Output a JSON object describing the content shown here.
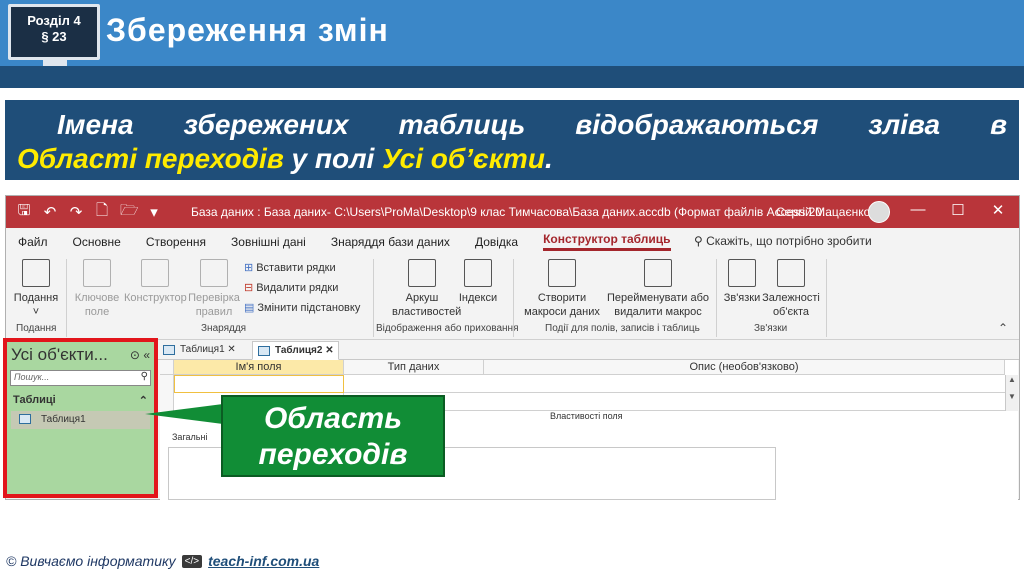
{
  "slide": {
    "section": "Розділ 4",
    "paragraph": "§ 23",
    "title": "Збереження змін"
  },
  "banner": {
    "line1": [
      "Імена",
      "збережених",
      "таблиць",
      "відображаються",
      "зліва",
      "в"
    ],
    "highlight1": "Області переходів",
    "middle": " у полі ",
    "highlight2": "Усі об’єкти",
    "end": "."
  },
  "window": {
    "title": "База даних : База даних- C:\\Users\\ProMa\\Desktop\\9 клас Тимчасова\\База даних.accdb (Формат файлів Access 20...",
    "user": "Сергій Мацаєнко",
    "menu": [
      "Файл",
      "Основне",
      "Створення",
      "Зовнішні дані",
      "Знаряддя бази даних",
      "Довідка",
      "Конструктор таблиць"
    ],
    "tell_me": "Скажіть, що потрібно зробити"
  },
  "ribbon": {
    "view": "Подання",
    "view_group": "Подання",
    "primary_key": "Ключове поле",
    "builder": "Конструктор",
    "test_rules": "Перевірка правил",
    "insert_rows": "Вставити рядки",
    "delete_rows": "Видалити рядки",
    "modify_lookups": "Змінити підстановку",
    "tools_group": "Знаряддя",
    "property_sheet": "Аркуш властивостей",
    "indexes": "Індекси",
    "showhide_group": "Відображення або приховання",
    "create_macros": "Створити макроси даних",
    "rename_macro": "Перейменувати або видалити макрос",
    "events_group": "Події для полів, записів і таблиць",
    "relationships": "Зв'язки",
    "dependencies": "Залежності об'єкта",
    "relations_group": "Зв'язки"
  },
  "nav": {
    "header": "Усі об'єкти...",
    "search_placeholder": "Пошук...",
    "category": "Таблиці",
    "item": "Таблиця1"
  },
  "tabs": [
    "Таблиця1",
    "Таблиця2"
  ],
  "grid": {
    "headers": [
      "Ім'я поля",
      "Тип даних",
      "Опис (необов'язково)"
    ],
    "properties": "Властивості поля",
    "general_tab": "Загальні"
  },
  "callout": {
    "line1": "Область",
    "line2": "переходів"
  },
  "footer": {
    "text": "© Вивчаємо інформатику",
    "code": "</>",
    "link": "teach-inf.com.ua"
  },
  "colors": {
    "header_blue": "#3b87c8",
    "dark_blue": "#1f4e79",
    "highlight": "#ffeb00",
    "access_red": "#b9353a",
    "callout_green": "#118d36",
    "nav_green": "#a9d7a0"
  }
}
